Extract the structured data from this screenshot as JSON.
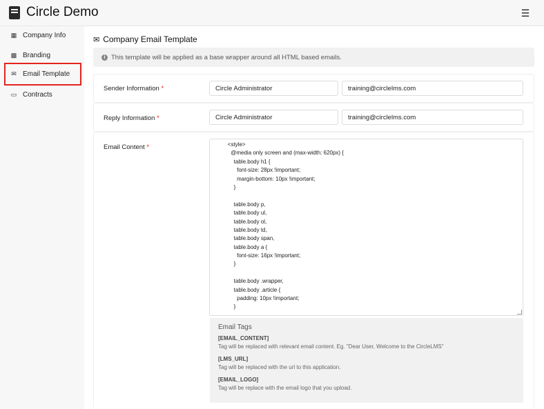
{
  "app": {
    "title": "Circle Demo",
    "logo_icon": "book-icon",
    "menu_icon": "hamburger-icon"
  },
  "sidebar": {
    "items": [
      {
        "label": "Company Info",
        "icon": "book-open-icon",
        "active": false
      },
      {
        "label": "Branding",
        "icon": "images-icon",
        "active": false
      },
      {
        "label": "Email Template",
        "icon": "envelope-icon",
        "active": true
      },
      {
        "label": "Contracts",
        "icon": "file-icon",
        "active": false
      }
    ],
    "highlight_color": "#e3231c"
  },
  "main": {
    "title": "Company Email Template",
    "info_text": "This template will be applied as a base wrapper around all HTML based emails.",
    "sender": {
      "label": "Sender Information",
      "name": "Circle Administrator",
      "email": "training@circlelms.com"
    },
    "reply": {
      "label": "Reply Information",
      "name": "Circle Administrator",
      "email": "training@circlelms.com"
    },
    "content": {
      "label": "Email Content",
      "lines": [
        "        <style>",
        "          @media only screen and (max-width: 620px) {",
        "            table.body h1 {",
        "              font-size: 28px !important;",
        "              margin-bottom: 10px !important;",
        "            }",
        "",
        "            table.body p,",
        "            table.body ul,",
        "            table.body ol,",
        "            table.body td,",
        "            table.body span,",
        "            table.body a {",
        "              font-size: 16px !important;",
        "            }",
        "",
        "            table.body .wrapper,",
        "            table.body .article {",
        "              padding: 10px !important;",
        "            }"
      ]
    },
    "tags": {
      "title": "Email Tags",
      "items": [
        {
          "name": "[EMAIL_CONTENT]",
          "desc": "Tag will be replaced with relevant email content. Eg. \"Dear User, Welcome to the CircleLMS\""
        },
        {
          "name": "[LMS_URL]",
          "desc": "Tag will be replaced with the url to this application."
        },
        {
          "name": "[EMAIL_LOGO]",
          "desc": "Tag will be replace with the email logo that you upload."
        }
      ]
    }
  }
}
